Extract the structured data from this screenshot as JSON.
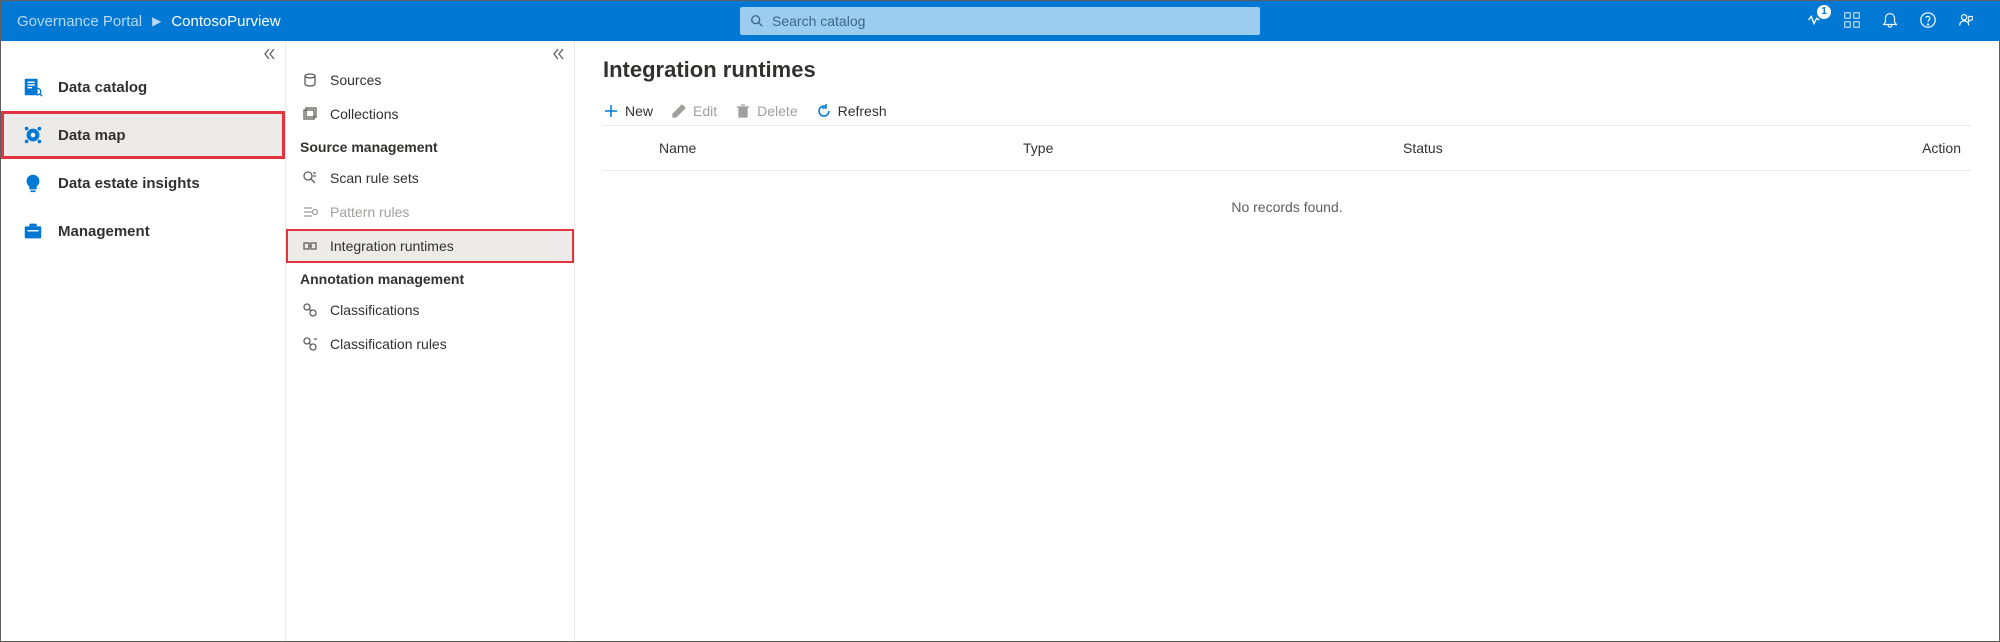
{
  "header": {
    "breadcrumb_root": "Governance Portal",
    "breadcrumb_current": "ContosoPurview",
    "search_placeholder": "Search catalog",
    "notification_count": "1"
  },
  "sidebar_primary": {
    "items": [
      {
        "label": "Data catalog"
      },
      {
        "label": "Data map"
      },
      {
        "label": "Data estate insights"
      },
      {
        "label": "Management"
      }
    ]
  },
  "sidebar_secondary": {
    "top": [
      {
        "label": "Sources"
      },
      {
        "label": "Collections"
      }
    ],
    "group_source_mgmt": "Source management",
    "source_mgmt": [
      {
        "label": "Scan rule sets"
      },
      {
        "label": "Pattern rules"
      },
      {
        "label": "Integration runtimes"
      }
    ],
    "group_annotation_mgmt": "Annotation management",
    "annotation_mgmt": [
      {
        "label": "Classifications"
      },
      {
        "label": "Classification rules"
      }
    ]
  },
  "main": {
    "title": "Integration runtimes",
    "toolbar": {
      "new": "New",
      "edit": "Edit",
      "delete": "Delete",
      "refresh": "Refresh"
    },
    "columns": {
      "name": "Name",
      "type": "Type",
      "status": "Status",
      "action": "Action"
    },
    "empty": "No records found."
  }
}
